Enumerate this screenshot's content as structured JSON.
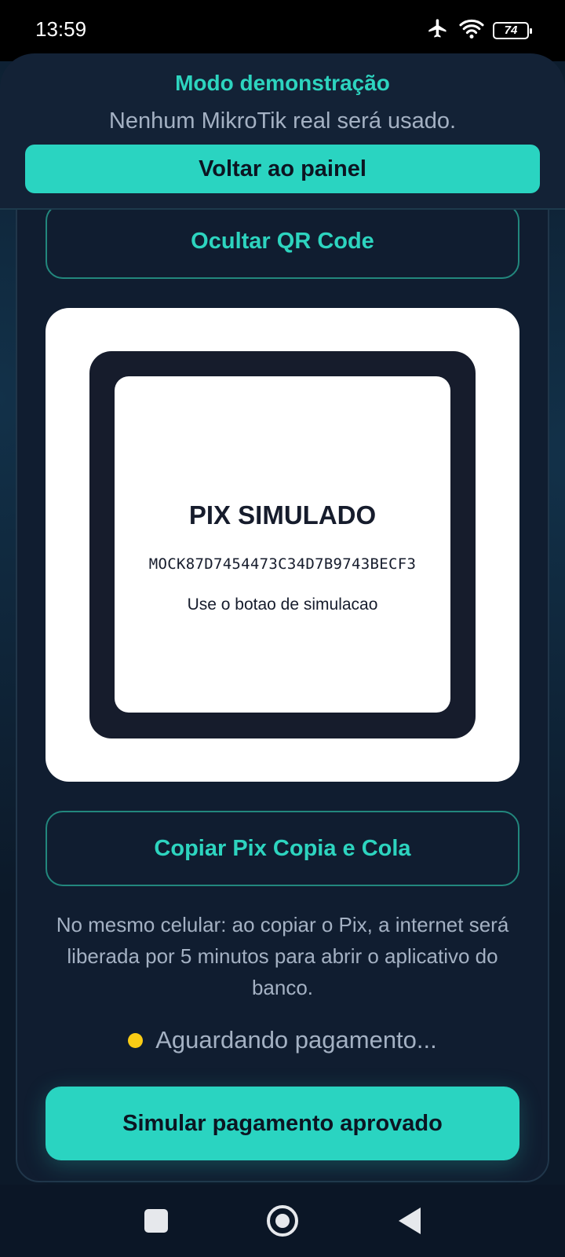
{
  "status_bar": {
    "time": "13:59",
    "battery": "74"
  },
  "demo_banner": {
    "title": "Modo demonstração",
    "subtitle": "Nenhum MikroTik real será usado.",
    "back_button_label": "Voltar ao painel"
  },
  "payment": {
    "hide_qr_label": "Ocultar QR Code",
    "qr": {
      "title": "PIX SIMULADO",
      "code": "MOCK87D7454473C34D7B9743BECF3",
      "hint": "Use o botao de simulacao"
    },
    "copy_pix_label": "Copiar Pix Copia e Cola",
    "info_text": "No mesmo celular: ao copiar o Pix, a internet será liberada por 5 minutos para abrir o aplicativo do banco.",
    "status_text": "Aguardando pagamento...",
    "simulate_label": "Simular pagamento aprovado"
  },
  "colors": {
    "accent": "#2ad4c1",
    "background": "#0d1a2b",
    "pending_dot": "#facc15"
  },
  "icons": {
    "status_bar": [
      "airplane-mode-icon",
      "wifi-icon",
      "battery-icon"
    ],
    "navigation": [
      "recent-apps-icon",
      "home-icon",
      "back-icon"
    ]
  }
}
